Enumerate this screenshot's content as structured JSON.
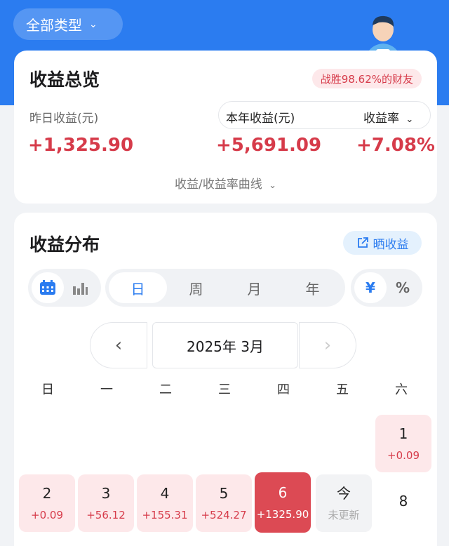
{
  "filter": {
    "label": "全部类型"
  },
  "overview": {
    "title": "收益总览",
    "beat_badge": "战胜98.62%的财友",
    "yesterday_label": "昨日收益(元)",
    "yesterday_value": "+1,325.90",
    "year_label": "本年收益(元)",
    "year_value": "+5,691.09",
    "rate_label": "收益率",
    "rate_value": "+7.08%",
    "curve_link": "收益/收益率曲线"
  },
  "distribution": {
    "title": "收益分布",
    "share_label": "晒收益",
    "periods": [
      "日",
      "周",
      "月",
      "年"
    ],
    "units": [
      "¥",
      "%"
    ],
    "month_label": "2025年 3月",
    "weekdays": [
      "日",
      "一",
      "二",
      "三",
      "四",
      "五",
      "六"
    ],
    "days": [
      {
        "day": "1",
        "gain": "+0.09"
      },
      {
        "day": "2",
        "gain": "+0.09"
      },
      {
        "day": "3",
        "gain": "+56.12"
      },
      {
        "day": "4",
        "gain": "+155.31"
      },
      {
        "day": "5",
        "gain": "+524.27"
      },
      {
        "day": "6",
        "gain": "+1325.90"
      },
      {
        "day": "今",
        "gain": "未更新"
      },
      {
        "day": "8",
        "gain": ""
      }
    ]
  }
}
